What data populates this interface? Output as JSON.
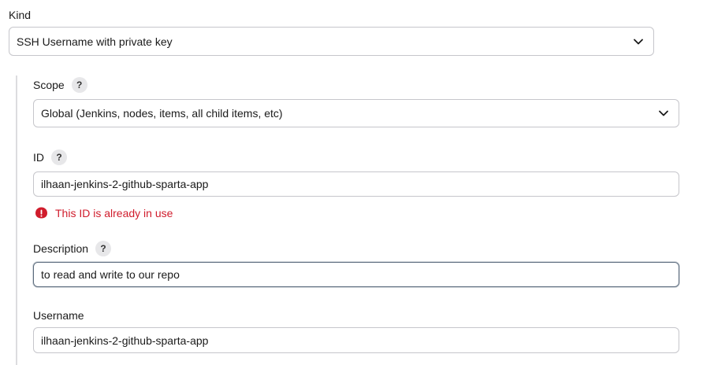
{
  "kind": {
    "label": "Kind",
    "value": "SSH Username with private key"
  },
  "scope": {
    "label": "Scope",
    "help": "?",
    "value": "Global (Jenkins, nodes, items, all child items, etc)"
  },
  "id_field": {
    "label": "ID",
    "help": "?",
    "value": "ilhaan-jenkins-2-github-sparta-app",
    "error": "This ID is already in use"
  },
  "description": {
    "label": "Description",
    "help": "?",
    "value": "to read and write to our repo"
  },
  "username": {
    "label": "Username",
    "value": "ilhaan-jenkins-2-github-sparta-app"
  },
  "colors": {
    "error": "#d01c2c",
    "border": "#c6c6cb",
    "focus_border": "#5b6b7d",
    "help_bg": "#e7e7e9"
  },
  "icons": {
    "dropdown": "chevron-down-icon",
    "error": "error-circle-icon",
    "help": "help-icon"
  }
}
